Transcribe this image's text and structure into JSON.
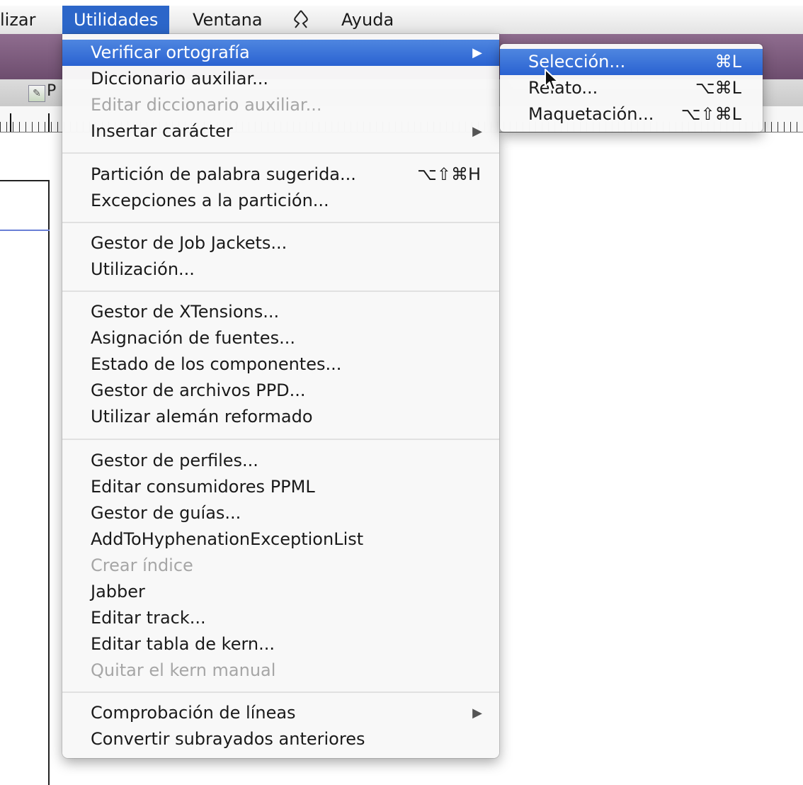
{
  "menubar": {
    "items": [
      "lizar",
      "Utilidades",
      "Ventana",
      "Ayuda"
    ],
    "script_icon": "script-menu-icon"
  },
  "toolbar": {
    "doc_letter": "P"
  },
  "main_menu": {
    "items": [
      {
        "label": "Verificar ortografía",
        "submenu": true,
        "highlight": true
      },
      {
        "label": "Diccionario auxiliar..."
      },
      {
        "label": "Editar diccionario auxiliar...",
        "disabled": true
      },
      {
        "label": "Insertar carácter",
        "submenu": true
      },
      {
        "label": "Partición de palabra sugerida...",
        "shortcut": "⌥⇧⌘H"
      },
      {
        "label": "Excepciones a la partición..."
      },
      {
        "label": "Gestor de Job Jackets..."
      },
      {
        "label": "Utilización..."
      },
      {
        "label": "Gestor de XTensions..."
      },
      {
        "label": "Asignación de fuentes..."
      },
      {
        "label": "Estado de los componentes..."
      },
      {
        "label": "Gestor de archivos PPD..."
      },
      {
        "label": "Utilizar alemán reformado"
      },
      {
        "label": "Gestor de perfiles..."
      },
      {
        "label": "Editar consumidores PPML"
      },
      {
        "label": "Gestor de guías..."
      },
      {
        "label": "AddToHyphenationExceptionList"
      },
      {
        "label": "Crear índice",
        "disabled": true
      },
      {
        "label": "Jabber"
      },
      {
        "label": "Editar track..."
      },
      {
        "label": "Editar tabla de kern..."
      },
      {
        "label": "Quitar el kern manual",
        "disabled": true
      },
      {
        "label": "Comprobación de líneas",
        "submenu": true
      },
      {
        "label": "Convertir subrayados anteriores"
      }
    ],
    "submenu_arrow": "▶"
  },
  "sub_menu": {
    "items": [
      {
        "label": "Selección...",
        "shortcut": "⌘L",
        "highlight": true
      },
      {
        "label": "Relato...",
        "shortcut": "⌥⌘L"
      },
      {
        "label": "Maquetación...",
        "shortcut": "⌥⇧⌘L"
      }
    ]
  },
  "colors": {
    "menu_highlight": "#2a62d1",
    "menubar_active": "#2c66c9",
    "title_bar": "#7a5a7b",
    "disabled_text": "#a6a6a6"
  }
}
